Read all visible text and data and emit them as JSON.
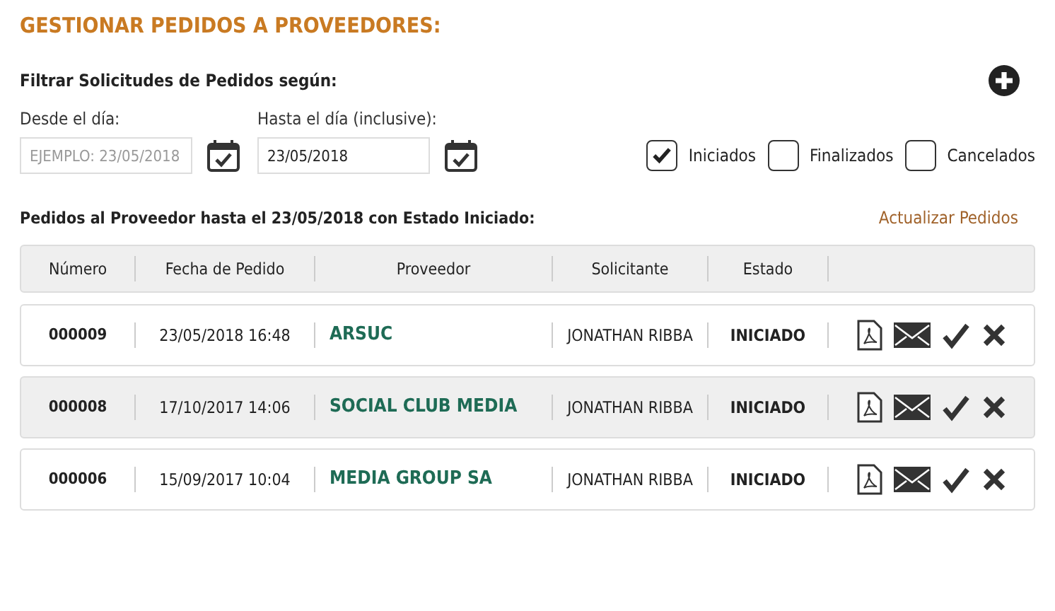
{
  "title": "GESTIONAR PEDIDOS A PROVEEDORES:",
  "filter": {
    "heading": "Filtrar Solicitudes de Pedidos según:",
    "from": {
      "label": "Desde el día:",
      "placeholder": "EJEMPLO: 23/05/2018"
    },
    "to": {
      "label": "Hasta el día (inclusive):",
      "value": "23/05/2018"
    },
    "statuses": [
      {
        "label": "Iniciados",
        "checked": true
      },
      {
        "label": "Finalizados",
        "checked": false
      },
      {
        "label": "Cancelados",
        "checked": false
      }
    ]
  },
  "results_heading": "Pedidos al Proveedor hasta el 23/05/2018 con Estado Iniciado:",
  "refresh_link": "Actualizar Pedidos",
  "table": {
    "columns": [
      "Número",
      "Fecha de Pedido",
      "Proveedor",
      "Solicitante",
      "Estado"
    ],
    "rows": [
      {
        "number": "000009",
        "date": "23/05/2018 16:48",
        "supplier": "ARSUC",
        "requester": "JONATHAN RIBBA",
        "status": "INICIADO"
      },
      {
        "number": "000008",
        "date": "17/10/2017 14:06",
        "supplier": "SOCIAL CLUB MEDIA",
        "requester": "JONATHAN RIBBA",
        "status": "INICIADO"
      },
      {
        "number": "000006",
        "date": "15/09/2017 10:04",
        "supplier": "MEDIA GROUP SA",
        "requester": "JONATHAN RIBBA",
        "status": "INICIADO"
      }
    ]
  }
}
